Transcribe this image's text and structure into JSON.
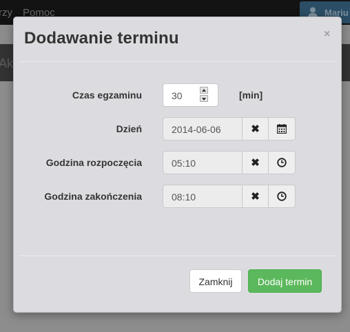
{
  "navbar": {
    "items": [
      {
        "label": "rzy"
      },
      {
        "label": "Pomoc"
      }
    ],
    "user_label": "Mariu"
  },
  "subbar": {
    "text": "Ak"
  },
  "modal": {
    "title": "Dodawanie terminu",
    "close_symbol": "×",
    "fields": {
      "duration": {
        "label": "Czas egzaminu",
        "value": "30",
        "unit": "[min]"
      },
      "day": {
        "label": "Dzień",
        "value": "2014-06-06",
        "clear_icon": "times-icon",
        "picker_icon": "calendar-icon"
      },
      "start_time": {
        "label": "Godzina rozpoczęcia",
        "value": "05:10",
        "clear_icon": "times-icon",
        "picker_icon": "clock-icon"
      },
      "end_time": {
        "label": "Godzina zakończenia",
        "value": "08:10",
        "clear_icon": "times-icon",
        "picker_icon": "clock-icon"
      }
    },
    "buttons": {
      "close_label": "Zamknij",
      "add_label": "Dodaj termin"
    }
  },
  "colors": {
    "primary_button": "#5cb85c",
    "navbar": "#131313",
    "user_button": "#2b4e66"
  }
}
